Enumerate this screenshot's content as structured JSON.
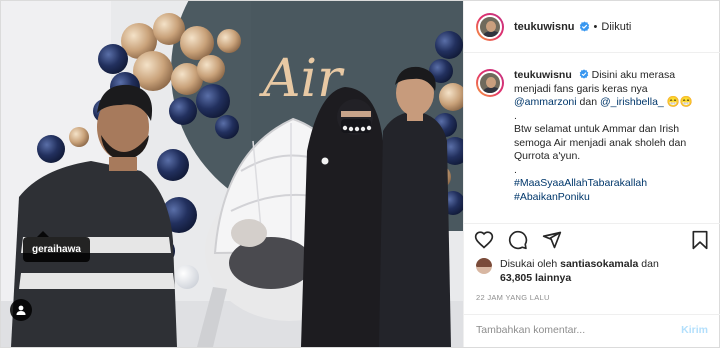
{
  "header": {
    "username": "teukuwisnu",
    "separator": "•",
    "follow_status": "Diikuti"
  },
  "caption": {
    "username": "teukuwisnu",
    "text1": "Disini aku merasa menjadi fans garis keras nya",
    "mention1": "@ammarzoni",
    "and": "dan",
    "mention2": "@_irishbella_",
    "emoji": "😁😁",
    "dot1": ".",
    "text2": "Btw selamat untuk Ammar dan Irish semoga Air menjadi anak sholeh dan Qurrota a'yun.",
    "dot2": ".",
    "hashtag1": "#MaaSyaaAllahTabarakallah",
    "hashtag2": "#AbaikanPoniku"
  },
  "photo": {
    "tagged_user": "geraihawa",
    "backdrop_sign": "Air"
  },
  "likes": {
    "prefix": "Disukai oleh",
    "user": "santiasokamala",
    "mid": "dan",
    "count": "63,805",
    "suffix": "lainnya"
  },
  "timestamp": "22 JAM YANG LALU",
  "comment": {
    "placeholder": "Tambahkan komentar...",
    "post_label": "Kirim"
  },
  "icons": {
    "like": "heart-icon",
    "comment": "comment-icon",
    "share": "share-icon",
    "save": "bookmark-icon",
    "verified": "verified-badge-icon",
    "user_tag": "user-tag-icon"
  },
  "colors": {
    "link": "#00376b",
    "verified": "#3897f0",
    "post_disabled": "#b2dffc",
    "muted": "#8e8e8e"
  }
}
